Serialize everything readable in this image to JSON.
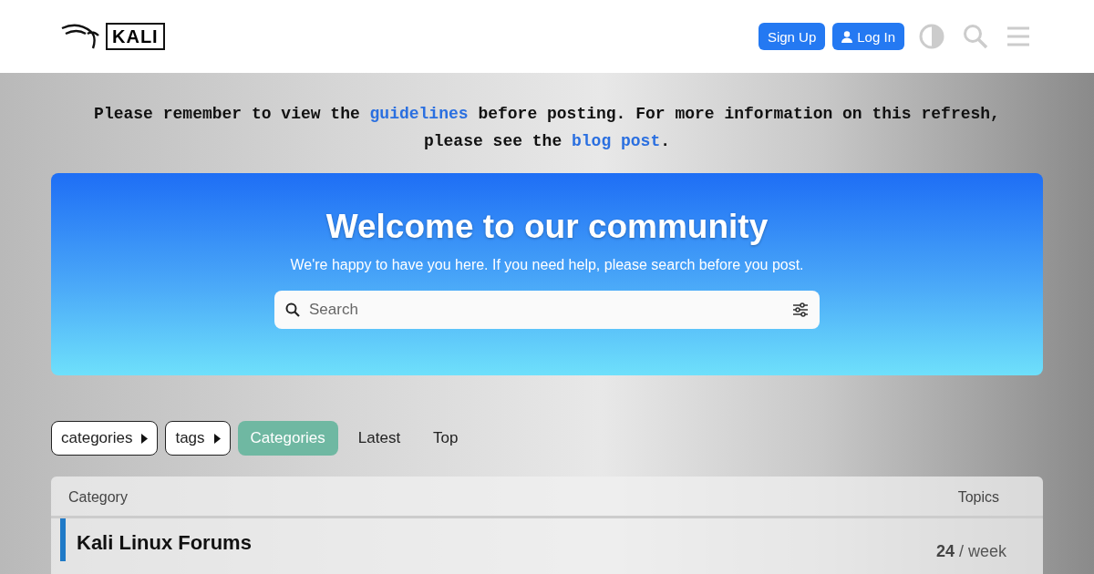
{
  "header": {
    "logo_text": "KALI",
    "buttons": [
      {
        "label": "Sign Up",
        "kind": "plain"
      },
      {
        "label": "Log In",
        "kind": "user"
      }
    ]
  },
  "notice": {
    "parts": [
      {
        "kind": "text",
        "text": "Please remember to view the "
      },
      {
        "kind": "link",
        "text": "guidelines"
      },
      {
        "kind": "text",
        "text": " before posting. For more information on this refresh, please see the "
      },
      {
        "kind": "link",
        "text": "blog post"
      },
      {
        "kind": "text",
        "text": "."
      }
    ]
  },
  "welcome": {
    "title": "Welcome to our community",
    "subtitle": "We're happy to have you here. If you need help, please search before you post.",
    "search": {
      "placeholder": "Search"
    }
  },
  "nav": [
    {
      "label": "categories",
      "kind": "dropdown",
      "selected": false
    },
    {
      "label": "tags",
      "kind": "dropdown",
      "selected": false
    },
    {
      "label": "Categories",
      "kind": "tab",
      "selected": true
    },
    {
      "label": "Latest",
      "kind": "tab",
      "selected": false
    },
    {
      "label": "Top",
      "kind": "tab",
      "selected": false
    }
  ],
  "table": {
    "columns": [
      "Category",
      "Topics"
    ],
    "rows": [
      {
        "name": "Kali Linux Forums",
        "count": "24",
        "period": "/ week",
        "color": "#1f7ac7"
      }
    ]
  }
}
